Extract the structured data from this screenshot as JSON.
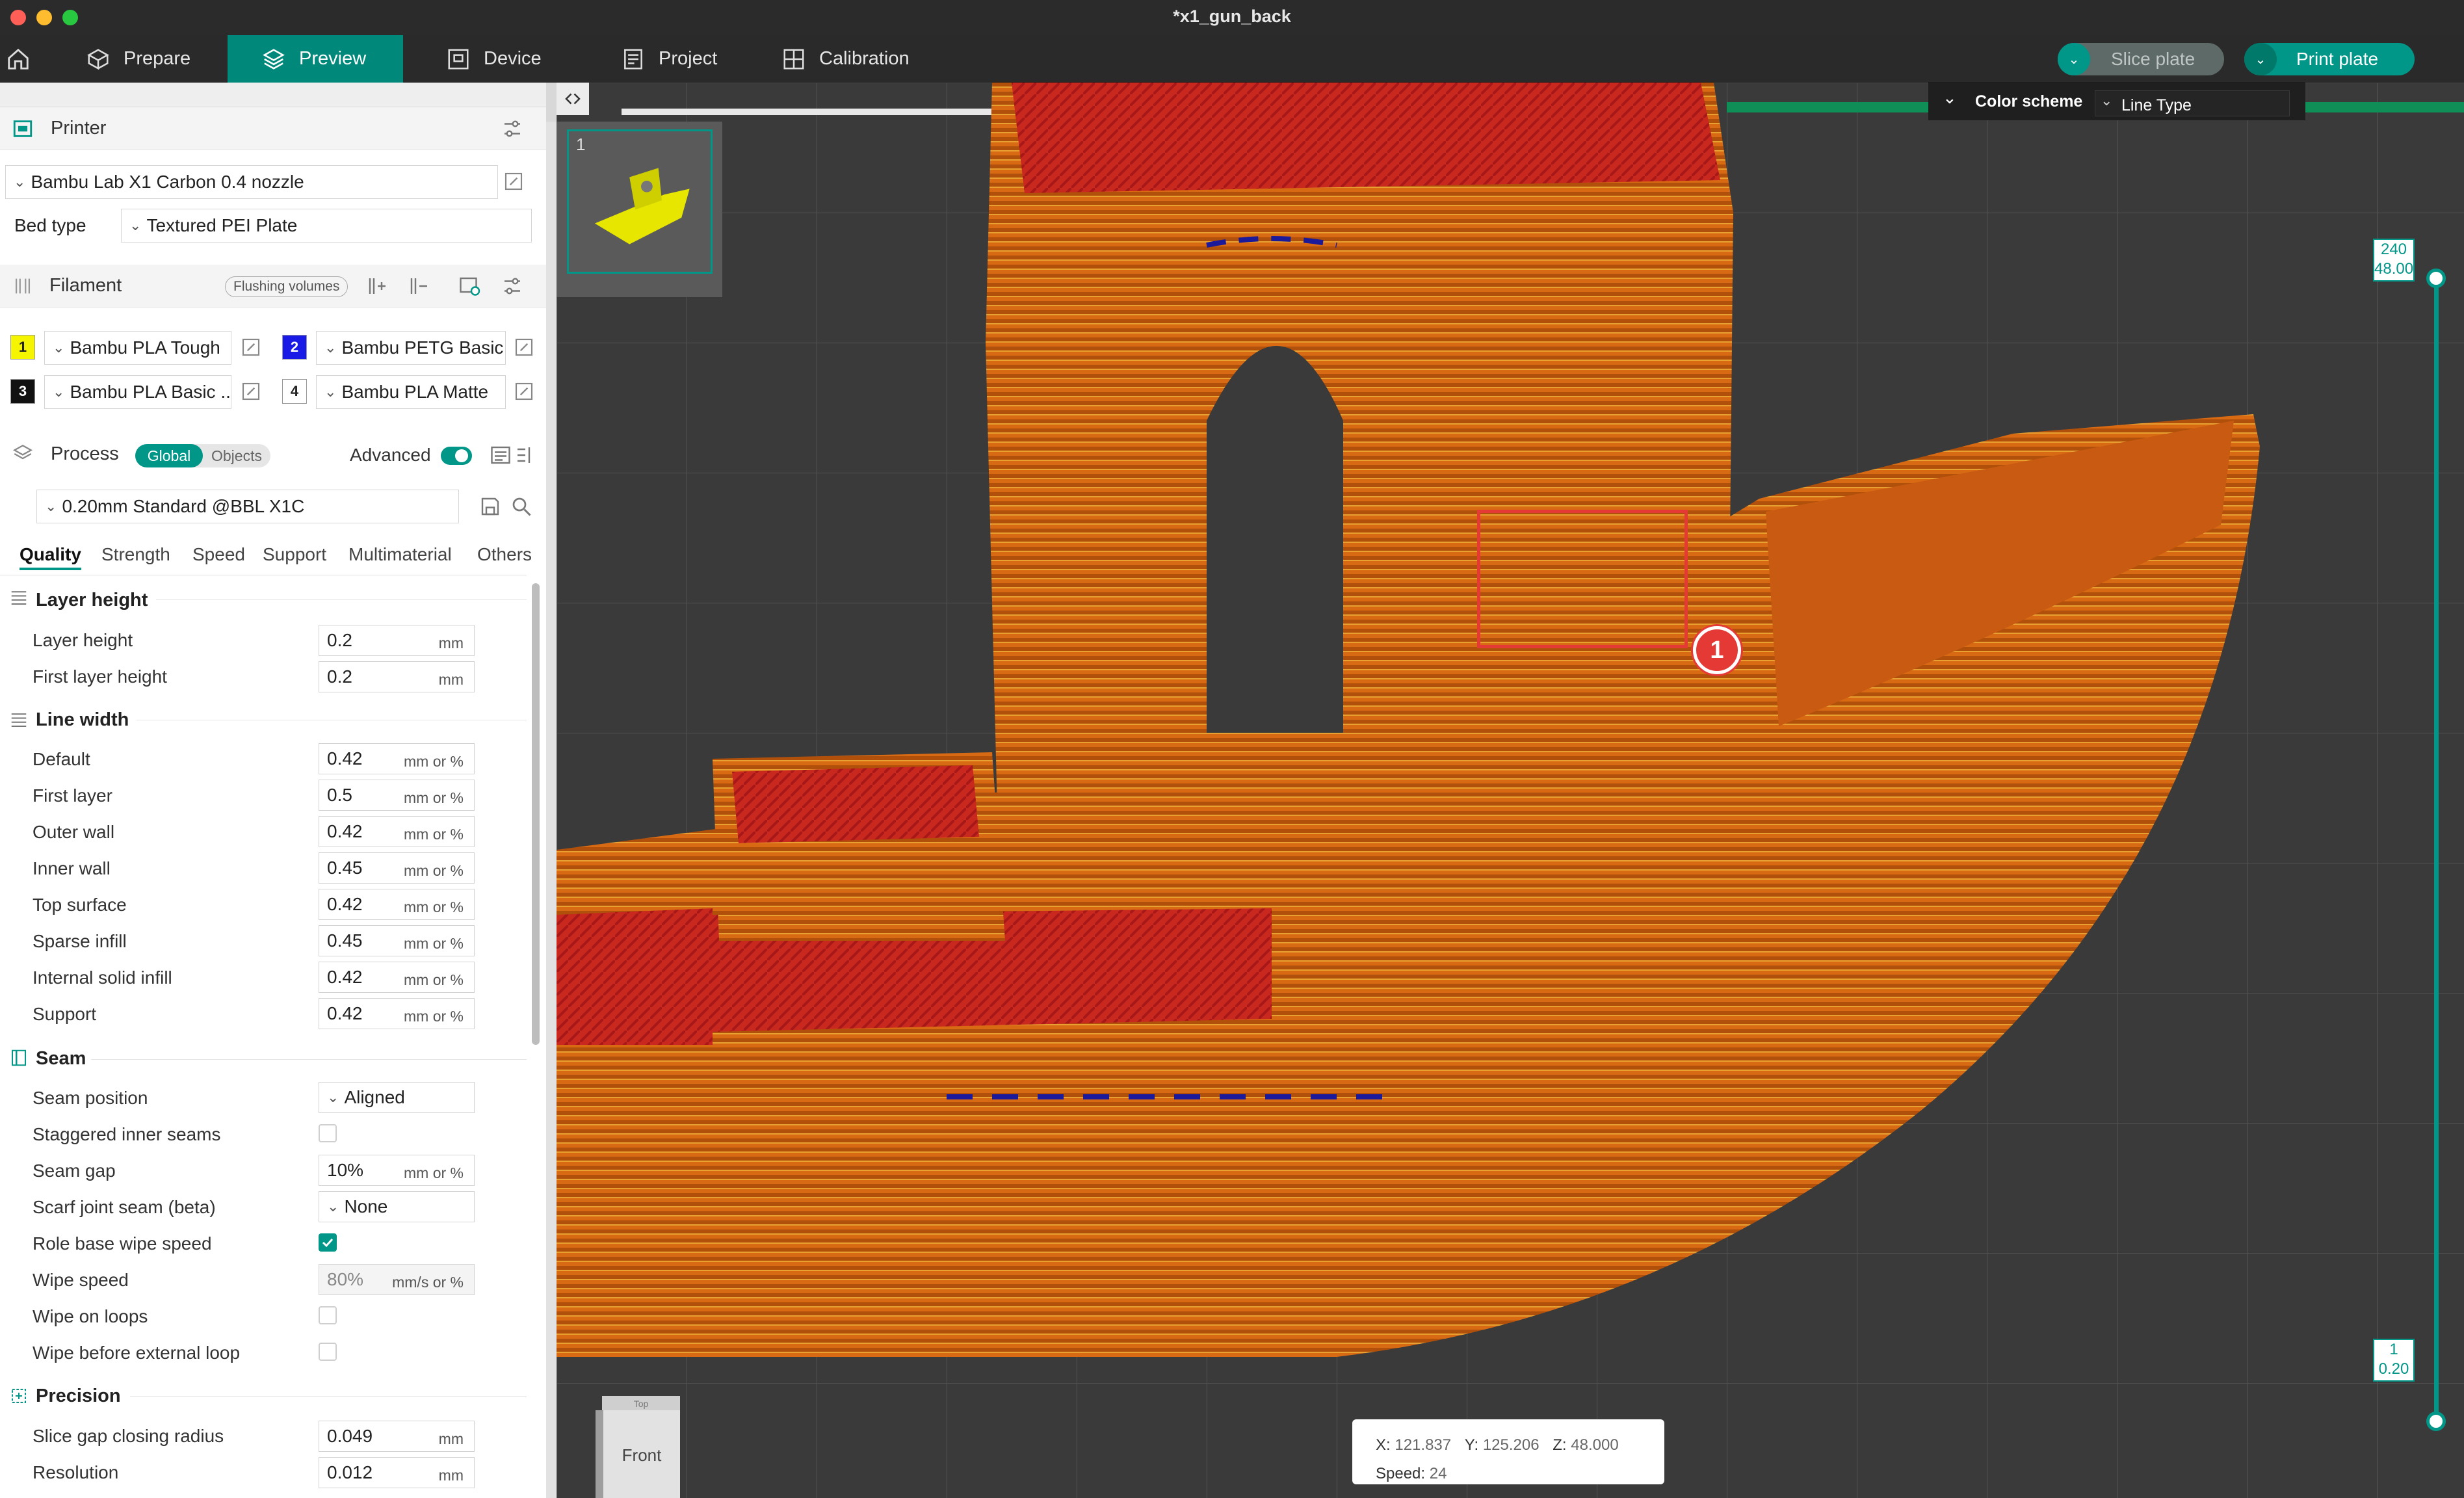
{
  "window": {
    "title": "*x1_gun_back"
  },
  "nav": {
    "prepare": "Prepare",
    "preview": "Preview",
    "device": "Device",
    "project": "Project",
    "calibration": "Calibration",
    "slice_plate": "Slice plate",
    "print_plate": "Print plate"
  },
  "printer": {
    "header": "Printer",
    "name": "Bambu Lab X1 Carbon 0.4 nozzle",
    "bed_type_label": "Bed type",
    "bed_type": "Textured PEI Plate"
  },
  "filament": {
    "header": "Filament",
    "flushing_label": "Flushing volumes",
    "items": [
      {
        "num": "1",
        "name": "Bambu PLA Tough",
        "color": "#f5f500"
      },
      {
        "num": "2",
        "name": "Bambu PETG Basic",
        "color": "#1a1ae6"
      },
      {
        "num": "3",
        "name": "Bambu PLA Basic ...",
        "color": "#111111"
      },
      {
        "num": "4",
        "name": "Bambu PLA Matte",
        "color": "#ffffff"
      }
    ]
  },
  "process": {
    "header": "Process",
    "global": "Global",
    "objects": "Objects",
    "advanced": "Advanced",
    "preset": "0.20mm Standard @BBL X1C"
  },
  "tabs": [
    "Quality",
    "Strength",
    "Speed",
    "Support",
    "Multimaterial",
    "Others"
  ],
  "quality": {
    "layer_height": {
      "title": "Layer height",
      "rows": [
        {
          "label": "Layer height",
          "value": "0.2",
          "unit": "mm"
        },
        {
          "label": "First layer height",
          "value": "0.2",
          "unit": "mm"
        }
      ]
    },
    "line_width": {
      "title": "Line width",
      "rows": [
        {
          "label": "Default",
          "value": "0.42",
          "unit": "mm or %"
        },
        {
          "label": "First layer",
          "value": "0.5",
          "unit": "mm or %"
        },
        {
          "label": "Outer wall",
          "value": "0.42",
          "unit": "mm or %"
        },
        {
          "label": "Inner wall",
          "value": "0.45",
          "unit": "mm or %"
        },
        {
          "label": "Top surface",
          "value": "0.42",
          "unit": "mm or %"
        },
        {
          "label": "Sparse infill",
          "value": "0.45",
          "unit": "mm or %"
        },
        {
          "label": "Internal solid infill",
          "value": "0.42",
          "unit": "mm or %"
        },
        {
          "label": "Support",
          "value": "0.42",
          "unit": "mm or %"
        }
      ]
    },
    "seam": {
      "title": "Seam",
      "seam_position_label": "Seam position",
      "seam_position": "Aligned",
      "staggered_label": "Staggered inner seams",
      "seam_gap_label": "Seam gap",
      "seam_gap": "10%",
      "seam_gap_unit": "mm or %",
      "scarf_label": "Scarf joint seam (beta)",
      "scarf": "None",
      "role_wipe_label": "Role base wipe speed",
      "wipe_speed_label": "Wipe speed",
      "wipe_speed": "80%",
      "wipe_speed_unit": "mm/s or %",
      "wipe_loops_label": "Wipe on loops",
      "wipe_before_label": "Wipe before external loop"
    },
    "precision": {
      "title": "Precision",
      "rows": [
        {
          "label": "Slice gap closing radius",
          "value": "0.049",
          "unit": "mm"
        },
        {
          "label": "Resolution",
          "value": "0.012",
          "unit": "mm"
        }
      ]
    }
  },
  "viewport": {
    "plate_number": "1",
    "color_scheme_label": "Color scheme",
    "color_scheme_value": "Line Type",
    "slider_top_layer": "240",
    "slider_top_height": "48.00",
    "slider_bottom_layer": "1",
    "slider_bottom_height": "0.20",
    "coord_x_label": "X:",
    "coord_x": "121.837",
    "coord_y_label": "Y:",
    "coord_y": "125.206",
    "coord_z_label": "Z:",
    "coord_z": "48.000",
    "speed_label": "Speed:",
    "speed": "24",
    "view_cube_front": "Front",
    "view_cube_top": "Top",
    "marker_label": "1"
  }
}
